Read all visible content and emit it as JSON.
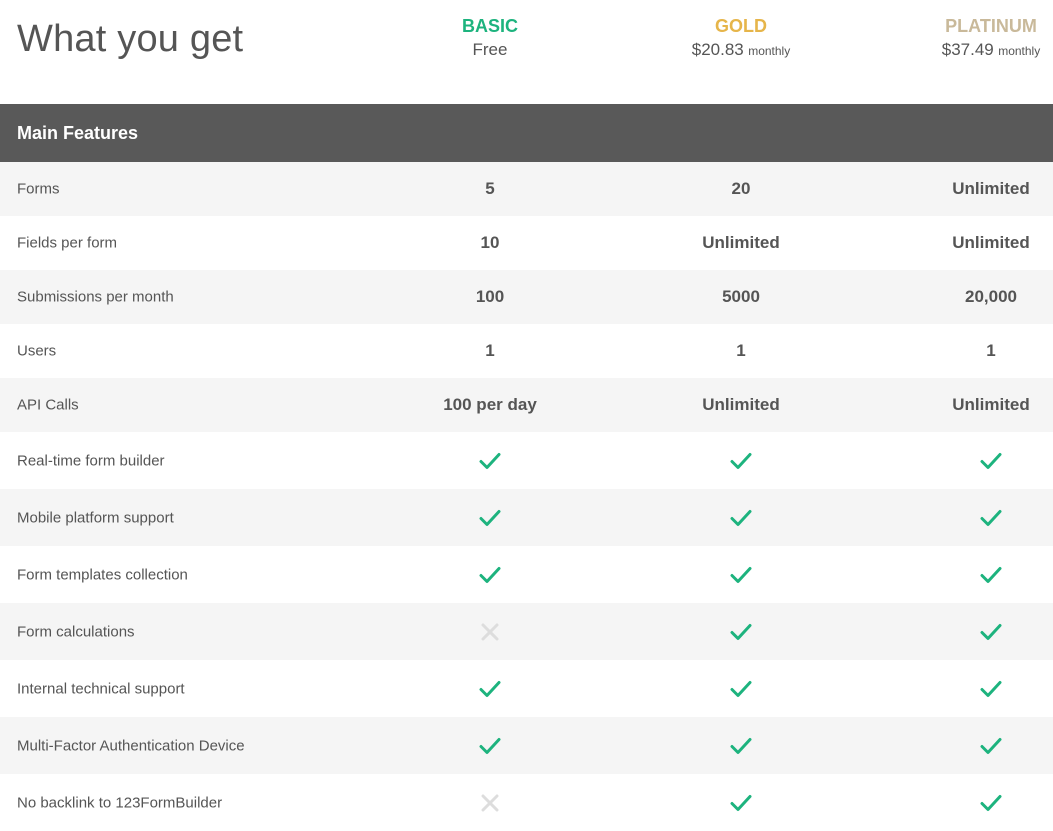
{
  "header": {
    "title": "What you get",
    "plans": [
      {
        "name": "BASIC",
        "price": "Free",
        "period": "",
        "color": "#1db37e"
      },
      {
        "name": "GOLD",
        "price": "$20.83",
        "period": "monthly",
        "color": "#e6b54a"
      },
      {
        "name": "PLATINUM",
        "price": "$37.49",
        "period": "monthly",
        "color": "#c9b99a"
      }
    ]
  },
  "section": {
    "label": "Main Features"
  },
  "value_rows": [
    {
      "feature": "Forms",
      "values": [
        "5",
        "20",
        "Unlimited"
      ]
    },
    {
      "feature": "Fields per form",
      "values": [
        "10",
        "Unlimited",
        "Unlimited"
      ]
    },
    {
      "feature": "Submissions per month",
      "values": [
        "100",
        "5000",
        "20,000"
      ]
    },
    {
      "feature": "Users",
      "values": [
        "1",
        "1",
        "1"
      ]
    },
    {
      "feature": "API Calls",
      "values": [
        "100 per day",
        "Unlimited",
        "Unlimited"
      ]
    }
  ],
  "check_rows": [
    {
      "feature": "Real-time form builder",
      "values": [
        true,
        true,
        true
      ]
    },
    {
      "feature": "Mobile platform support",
      "values": [
        true,
        true,
        true
      ]
    },
    {
      "feature": "Form templates collection",
      "values": [
        true,
        true,
        true
      ]
    },
    {
      "feature": "Form calculations",
      "values": [
        false,
        true,
        true
      ]
    },
    {
      "feature": "Internal technical support",
      "values": [
        true,
        true,
        true
      ]
    },
    {
      "feature": "Multi-Factor Authentication Device",
      "values": [
        true,
        true,
        true
      ]
    },
    {
      "feature": "No backlink to 123FormBuilder",
      "values": [
        false,
        true,
        true
      ]
    }
  ],
  "icons": {
    "included": "check-icon",
    "excluded": "cross-icon"
  },
  "colors": {
    "check": "#1db37e",
    "cross": "#dddddd",
    "section_bar": "#595959"
  }
}
